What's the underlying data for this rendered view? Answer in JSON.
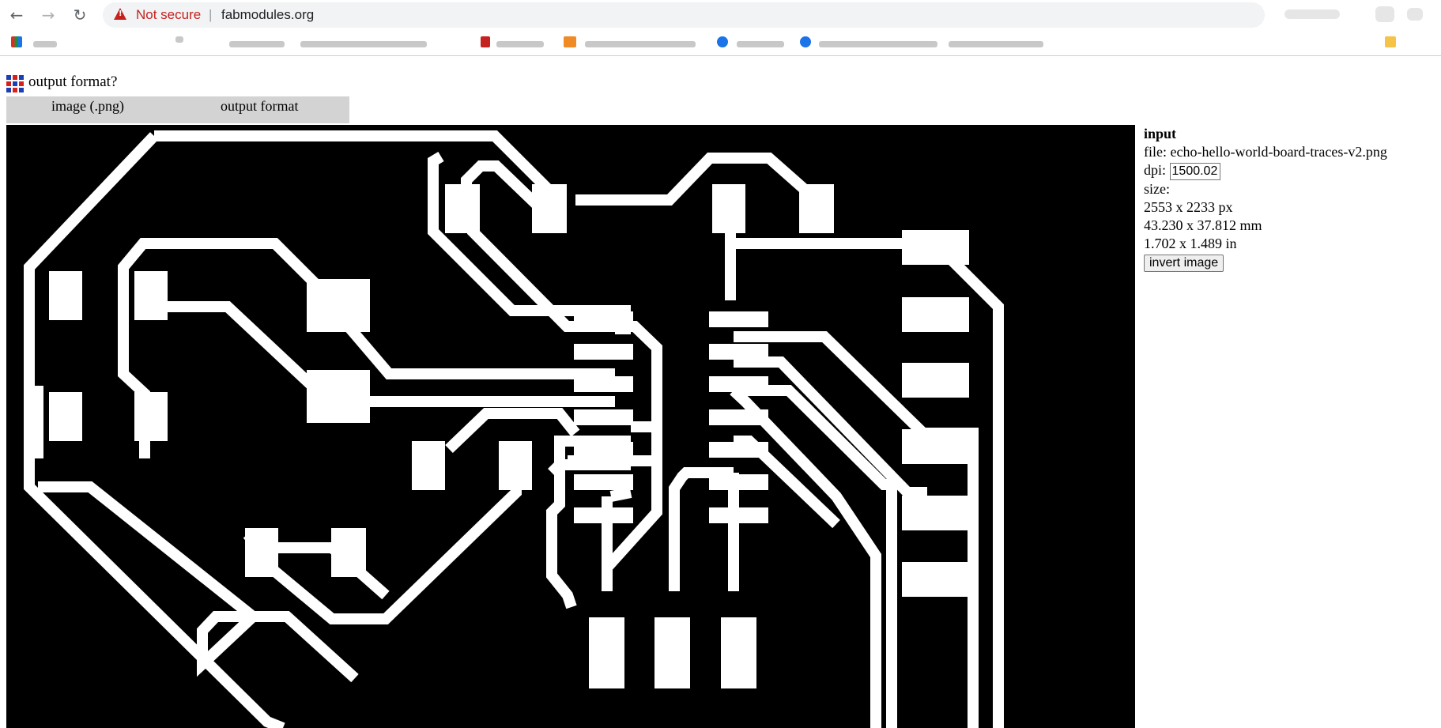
{
  "browser": {
    "back_icon": "arrow-left-icon",
    "forward_icon": "arrow-right-icon",
    "reload_icon": "reload-icon",
    "security_label": "Not secure",
    "separator": "|",
    "url": "fabmodules.org",
    "warning_color": "#c5221f"
  },
  "app": {
    "title": "output format?",
    "formats": [
      "image (.png)",
      "output format"
    ]
  },
  "input_panel": {
    "heading": "input",
    "file_label": "file:",
    "file_name": "echo-hello-world-board-traces-v2.png",
    "dpi_label": "dpi:",
    "dpi_value": "1500.02",
    "size_label": "size:",
    "size_px": "2553 x 2233 px",
    "size_mm": "43.230 x 37.812 mm",
    "size_in": "1.702 x 1.489 in",
    "invert_label": "invert image"
  }
}
